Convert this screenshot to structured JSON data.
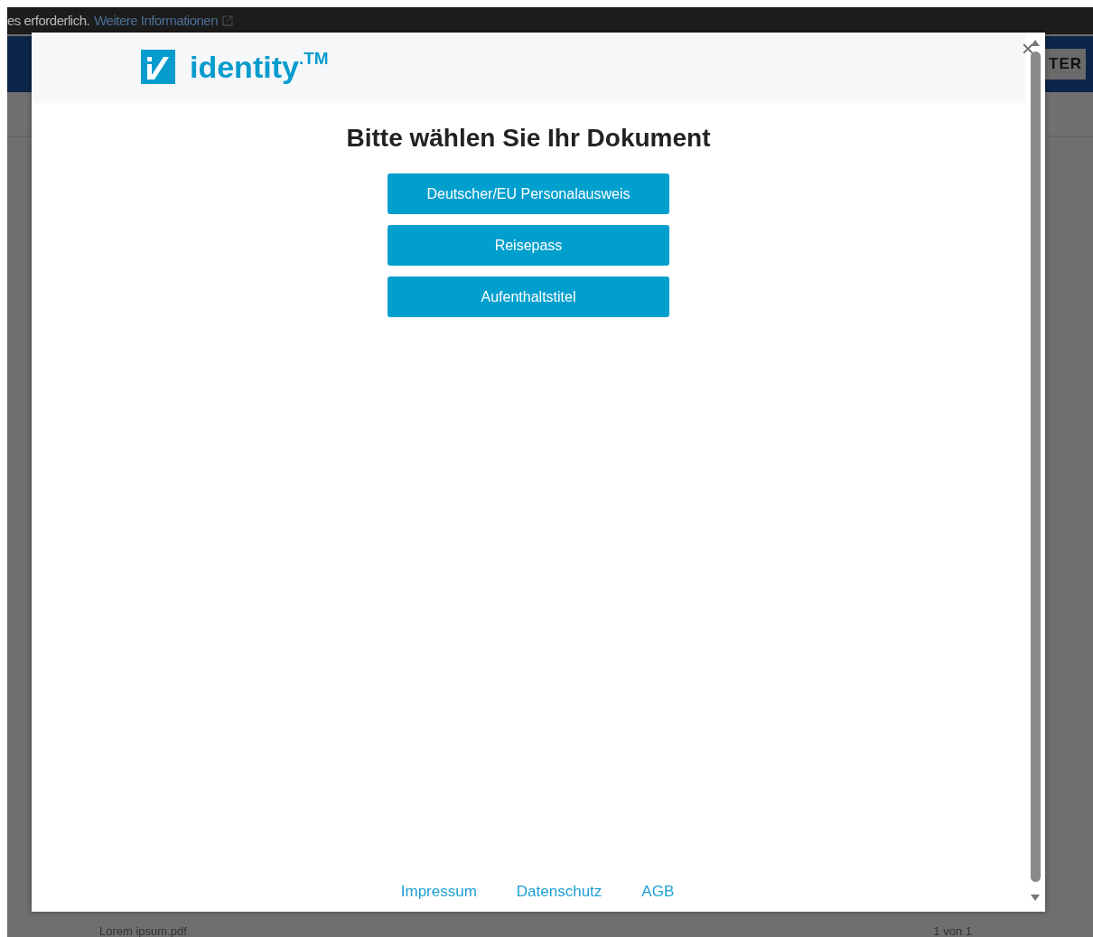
{
  "cookie_bar": {
    "text": "es erforderlich.",
    "link": "Weitere Informationen"
  },
  "nav": {
    "text": "TER"
  },
  "background_file": {
    "name": "Lorem ipsum.pdf",
    "pages": "1 von 1"
  },
  "dialog": {
    "close": "×",
    "logo": {
      "word": "identity",
      "mark": ".TM"
    },
    "title": "Bitte wählen Sie Ihr Dokument",
    "buttons": [
      "Deutscher/EU Personalausweis",
      "Reisepass",
      "Aufenthaltstitel"
    ],
    "footer_links": [
      "Impressum",
      "Datenschutz",
      "AGB"
    ]
  }
}
